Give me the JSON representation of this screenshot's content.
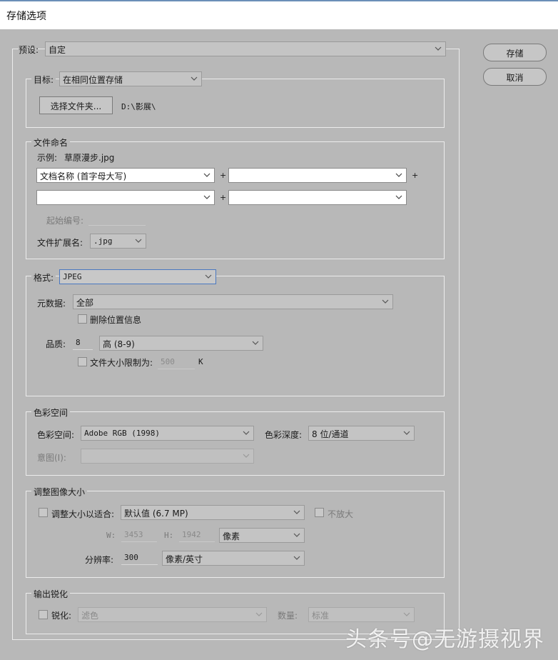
{
  "window": {
    "title": "存储选项"
  },
  "preset": {
    "label": "预设:",
    "value": "自定"
  },
  "buttons": {
    "save": "存储",
    "cancel": "取消"
  },
  "destination": {
    "label": "目标:",
    "value": "在相同位置存储",
    "choose_folder": "选择文件夹...",
    "path": "D:\\影展\\"
  },
  "file_naming": {
    "legend": "文件命名",
    "example_label": "示例:",
    "example_value": "草原漫步.jpg",
    "field1": "文档名称 (首字母大写)",
    "field2": "",
    "field3": "",
    "field4": "",
    "plus": "+",
    "start_number_label": "起始编号:",
    "extension_label": "文件扩展名:",
    "extension_value": ".jpg"
  },
  "format": {
    "label": "格式:",
    "value": "JPEG",
    "metadata_label": "元数据:",
    "metadata_value": "全部",
    "strip_location": "删除位置信息",
    "quality_label": "品质:",
    "quality_value": "8",
    "quality_preset": "高 (8-9)",
    "limit_size_label": "文件大小限制为:",
    "limit_size_value": "500",
    "limit_size_unit": "K"
  },
  "color_space": {
    "legend": "色彩空间",
    "space_label": "色彩空间:",
    "space_value": "Adobe RGB (1998)",
    "depth_label": "色彩深度:",
    "depth_value": "8 位/通道",
    "intent_label": "意图(I):",
    "intent_value": ""
  },
  "resize": {
    "legend": "调整图像大小",
    "fit_label": "调整大小以适合:",
    "fit_value": "默认值 (6.7 MP)",
    "no_enlarge": "不放大",
    "w_label": "W:",
    "w_value": "3453",
    "h_label": "H:",
    "h_value": "1942",
    "unit": "像素",
    "resolution_label": "分辨率:",
    "resolution_value": "300",
    "resolution_unit": "像素/英寸"
  },
  "sharpen": {
    "legend": "输出锐化",
    "sharpen_label": "锐化:",
    "sharpen_value": "滤色",
    "amount_label": "数量:",
    "amount_value": "标准"
  },
  "watermark": "头条号@无游摄视界",
  "colors": {
    "panel": "#b8b8b8",
    "focus": "#4a78c0",
    "title_accent": "#6b8fb8"
  }
}
